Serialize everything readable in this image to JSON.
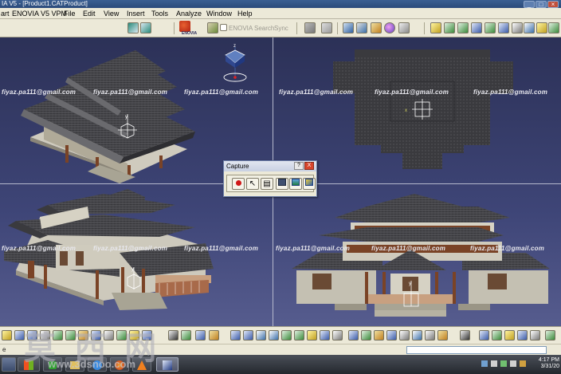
{
  "window": {
    "title": "IA V5 - [Product1.CATProduct]"
  },
  "menubar": {
    "items": [
      "art",
      "ENOVIA V5 VPM",
      "File",
      "Edit",
      "View",
      "Insert",
      "Tools",
      "Analyze",
      "Window",
      "Help"
    ]
  },
  "toolbar": {
    "enovia_label": "ENOVIA",
    "ghost_label_1": "ENOVIA Search",
    "ghost_label_2": "Sync"
  },
  "viewport": {
    "watermark": "fiyaz.pa111@gmail.com"
  },
  "capture_dialog": {
    "title": "Capture",
    "help_label": "?",
    "close_label": "X"
  },
  "statusbar": {
    "text": "e"
  },
  "watermarks": {
    "site_cn": "莫 西 网",
    "site_url": "www.3dsnoo.com"
  },
  "taskbar": {
    "time": "4:17 PM",
    "date": "3/31/20"
  },
  "colors": {
    "viewport_top": "#2c3157",
    "viewport_bottom": "#565c8e",
    "roof": "#4a4a4e",
    "wood": "#7a4326",
    "wall": "#d8d4c8",
    "taskbar": "#24282e",
    "menubar": "#ece9d8"
  }
}
